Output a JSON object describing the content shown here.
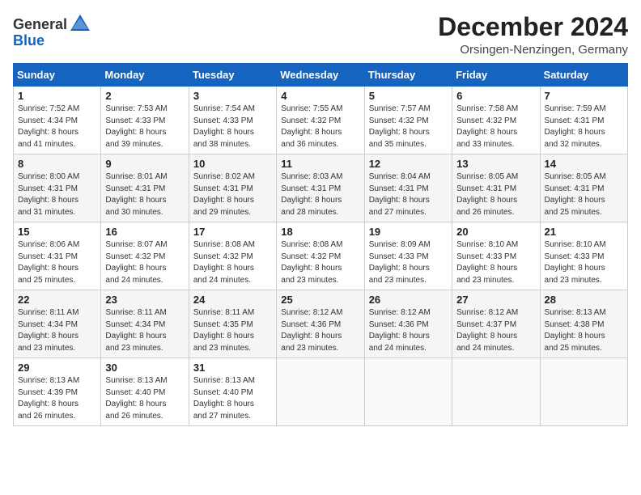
{
  "header": {
    "logo_general": "General",
    "logo_blue": "Blue",
    "month_title": "December 2024",
    "location": "Orsingen-Nenzingen, Germany"
  },
  "days_of_week": [
    "Sunday",
    "Monday",
    "Tuesday",
    "Wednesday",
    "Thursday",
    "Friday",
    "Saturday"
  ],
  "weeks": [
    [
      {
        "day": 1,
        "info": "Sunrise: 7:52 AM\nSunset: 4:34 PM\nDaylight: 8 hours\nand 41 minutes."
      },
      {
        "day": 2,
        "info": "Sunrise: 7:53 AM\nSunset: 4:33 PM\nDaylight: 8 hours\nand 39 minutes."
      },
      {
        "day": 3,
        "info": "Sunrise: 7:54 AM\nSunset: 4:33 PM\nDaylight: 8 hours\nand 38 minutes."
      },
      {
        "day": 4,
        "info": "Sunrise: 7:55 AM\nSunset: 4:32 PM\nDaylight: 8 hours\nand 36 minutes."
      },
      {
        "day": 5,
        "info": "Sunrise: 7:57 AM\nSunset: 4:32 PM\nDaylight: 8 hours\nand 35 minutes."
      },
      {
        "day": 6,
        "info": "Sunrise: 7:58 AM\nSunset: 4:32 PM\nDaylight: 8 hours\nand 33 minutes."
      },
      {
        "day": 7,
        "info": "Sunrise: 7:59 AM\nSunset: 4:31 PM\nDaylight: 8 hours\nand 32 minutes."
      }
    ],
    [
      {
        "day": 8,
        "info": "Sunrise: 8:00 AM\nSunset: 4:31 PM\nDaylight: 8 hours\nand 31 minutes."
      },
      {
        "day": 9,
        "info": "Sunrise: 8:01 AM\nSunset: 4:31 PM\nDaylight: 8 hours\nand 30 minutes."
      },
      {
        "day": 10,
        "info": "Sunrise: 8:02 AM\nSunset: 4:31 PM\nDaylight: 8 hours\nand 29 minutes."
      },
      {
        "day": 11,
        "info": "Sunrise: 8:03 AM\nSunset: 4:31 PM\nDaylight: 8 hours\nand 28 minutes."
      },
      {
        "day": 12,
        "info": "Sunrise: 8:04 AM\nSunset: 4:31 PM\nDaylight: 8 hours\nand 27 minutes."
      },
      {
        "day": 13,
        "info": "Sunrise: 8:05 AM\nSunset: 4:31 PM\nDaylight: 8 hours\nand 26 minutes."
      },
      {
        "day": 14,
        "info": "Sunrise: 8:05 AM\nSunset: 4:31 PM\nDaylight: 8 hours\nand 25 minutes."
      }
    ],
    [
      {
        "day": 15,
        "info": "Sunrise: 8:06 AM\nSunset: 4:31 PM\nDaylight: 8 hours\nand 25 minutes."
      },
      {
        "day": 16,
        "info": "Sunrise: 8:07 AM\nSunset: 4:32 PM\nDaylight: 8 hours\nand 24 minutes."
      },
      {
        "day": 17,
        "info": "Sunrise: 8:08 AM\nSunset: 4:32 PM\nDaylight: 8 hours\nand 24 minutes."
      },
      {
        "day": 18,
        "info": "Sunrise: 8:08 AM\nSunset: 4:32 PM\nDaylight: 8 hours\nand 23 minutes."
      },
      {
        "day": 19,
        "info": "Sunrise: 8:09 AM\nSunset: 4:33 PM\nDaylight: 8 hours\nand 23 minutes."
      },
      {
        "day": 20,
        "info": "Sunrise: 8:10 AM\nSunset: 4:33 PM\nDaylight: 8 hours\nand 23 minutes."
      },
      {
        "day": 21,
        "info": "Sunrise: 8:10 AM\nSunset: 4:33 PM\nDaylight: 8 hours\nand 23 minutes."
      }
    ],
    [
      {
        "day": 22,
        "info": "Sunrise: 8:11 AM\nSunset: 4:34 PM\nDaylight: 8 hours\nand 23 minutes."
      },
      {
        "day": 23,
        "info": "Sunrise: 8:11 AM\nSunset: 4:34 PM\nDaylight: 8 hours\nand 23 minutes."
      },
      {
        "day": 24,
        "info": "Sunrise: 8:11 AM\nSunset: 4:35 PM\nDaylight: 8 hours\nand 23 minutes."
      },
      {
        "day": 25,
        "info": "Sunrise: 8:12 AM\nSunset: 4:36 PM\nDaylight: 8 hours\nand 23 minutes."
      },
      {
        "day": 26,
        "info": "Sunrise: 8:12 AM\nSunset: 4:36 PM\nDaylight: 8 hours\nand 24 minutes."
      },
      {
        "day": 27,
        "info": "Sunrise: 8:12 AM\nSunset: 4:37 PM\nDaylight: 8 hours\nand 24 minutes."
      },
      {
        "day": 28,
        "info": "Sunrise: 8:13 AM\nSunset: 4:38 PM\nDaylight: 8 hours\nand 25 minutes."
      }
    ],
    [
      {
        "day": 29,
        "info": "Sunrise: 8:13 AM\nSunset: 4:39 PM\nDaylight: 8 hours\nand 26 minutes."
      },
      {
        "day": 30,
        "info": "Sunrise: 8:13 AM\nSunset: 4:40 PM\nDaylight: 8 hours\nand 26 minutes."
      },
      {
        "day": 31,
        "info": "Sunrise: 8:13 AM\nSunset: 4:40 PM\nDaylight: 8 hours\nand 27 minutes."
      },
      null,
      null,
      null,
      null
    ]
  ]
}
